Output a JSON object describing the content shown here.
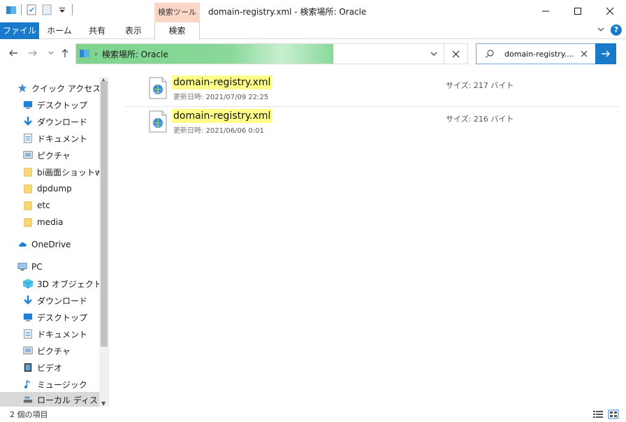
{
  "window": {
    "title": "domain-registry.xml - 検索場所: Oracle",
    "context_tab_group": "検索ツール"
  },
  "ribbon": {
    "tabs": [
      {
        "label": "ファイル",
        "active": true
      },
      {
        "label": "ホーム"
      },
      {
        "label": "共有"
      },
      {
        "label": "表示"
      },
      {
        "label": "検索"
      }
    ]
  },
  "address": {
    "separator": "›",
    "path": "検索場所: Oracle",
    "progress": 0.7
  },
  "search": {
    "value": "domain-registry...."
  },
  "nav": {
    "items": [
      {
        "label": "クイック アクセス",
        "icon": "star-icon"
      },
      {
        "label": "デスクトップ",
        "icon": "desktop-icon",
        "pinned": true
      },
      {
        "label": "ダウンロード",
        "icon": "download-icon",
        "pinned": true
      },
      {
        "label": "ドキュメント",
        "icon": "document-icon",
        "pinned": true
      },
      {
        "label": "ピクチャ",
        "icon": "pictures-icon",
        "pinned": true
      },
      {
        "label": "bi画面ショットwin",
        "icon": "folder-icon"
      },
      {
        "label": "dpdump",
        "icon": "folder-icon"
      },
      {
        "label": "etc",
        "icon": "folder-icon"
      },
      {
        "label": "media",
        "icon": "folder-icon"
      },
      {
        "label": "OneDrive",
        "icon": "cloud-icon"
      },
      {
        "label": "PC",
        "icon": "pc-icon"
      },
      {
        "label": "3D オブジェクト",
        "icon": "cube-icon"
      },
      {
        "label": "ダウンロード",
        "icon": "download-icon"
      },
      {
        "label": "デスクトップ",
        "icon": "desktop-icon"
      },
      {
        "label": "ドキュメント",
        "icon": "document-icon"
      },
      {
        "label": "ピクチャ",
        "icon": "pictures-icon"
      },
      {
        "label": "ビデオ",
        "icon": "video-icon"
      },
      {
        "label": "ミュージック",
        "icon": "music-icon"
      },
      {
        "label": "ローカル ディスク (C",
        "icon": "disk-icon",
        "selected": true
      }
    ]
  },
  "results": [
    {
      "name": "domain-registry.xml",
      "date_label": "更新日時:",
      "date": "2021/07/09 22:25",
      "size_label": "サイズ:",
      "size": "217 バイト"
    },
    {
      "name": "domain-registry.xml",
      "date_label": "更新日時:",
      "date": "2021/06/06 0:01",
      "size_label": "サイズ:",
      "size": "216 バイト"
    }
  ],
  "status": {
    "count": "2 個の項目"
  },
  "colors": {
    "accent": "#1979ca",
    "context_tab": "#fbd6c6",
    "progress": "#7ed48e",
    "highlight": "#ffff88"
  }
}
